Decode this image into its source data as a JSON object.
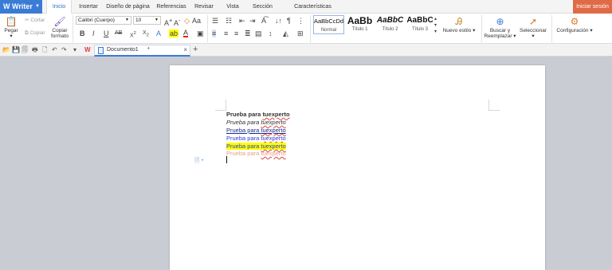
{
  "app": {
    "name": "Writer"
  },
  "tabs": [
    "Inicio",
    "Insertar",
    "Diseño de página",
    "Referencias",
    "Revisar",
    "Vista",
    "Sección",
    "Características especiales"
  ],
  "login_label": "Iniciar sesión",
  "clipboard": {
    "paste": "Pegar",
    "cut": "Cortar",
    "copy": "Copiar",
    "format_painter_line1": "Copiar",
    "format_painter_line2": "formato"
  },
  "font": {
    "name": "Calibri (Cuerpo)",
    "size": "10"
  },
  "styles": [
    {
      "sample": "AaBbCcDd",
      "label": "Normal"
    },
    {
      "sample": "AaBb",
      "label": "Título 1"
    },
    {
      "sample": "AaBbC",
      "label": "Título 2"
    },
    {
      "sample": "AaBbC",
      "label": "Título 3"
    }
  ],
  "ribbon_buttons": {
    "new_style": "Nuevo estilo",
    "find_line1": "Buscar y",
    "find_line2": "Reemplazar",
    "select": "Seleccionar",
    "settings": "Configuración"
  },
  "document": {
    "tab_title": "Documento1",
    "lines": [
      {
        "plain": "Prueba para ",
        "link": "tuexperto",
        "style": "bold",
        "color": "#111111"
      },
      {
        "plain": "Prueba para ",
        "link": "tuexperto",
        "style": "italic",
        "color": "#111111"
      },
      {
        "plain": "Prueba para ",
        "link": "tuexperto",
        "style": "underline",
        "color": "#1a2a8a"
      },
      {
        "plain": "Prueba para ",
        "link": "tuexperto",
        "style": "normal",
        "color": "#2b3fd6"
      },
      {
        "plain": "Prueba para ",
        "link": "tuexperto",
        "style": "highlight",
        "color": "#2b3fd6"
      },
      {
        "plain": "Prueba para ",
        "link": "tuexperto",
        "style": "faded",
        "color": "#e6a08a"
      }
    ]
  },
  "colors": {
    "accent": "#3a7bd5",
    "login": "#e06a46",
    "highlight": "#ffff00"
  }
}
